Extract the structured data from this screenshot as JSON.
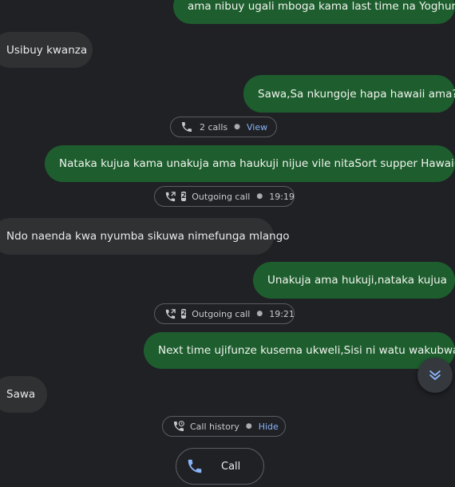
{
  "messages": [
    {
      "dir": "out",
      "text": "ama nibuy ugali mboga kama last time na Yoghurt?"
    },
    {
      "dir": "in",
      "text": "Usibuy kwanza"
    },
    {
      "dir": "out",
      "text": "Sawa,Sa nkungoje hapa hawaii ama?"
    },
    {
      "dir": "out",
      "text": "Nataka kujua kama unakuja ama haukuji nijue vile nitaSort supper Hawaii?"
    },
    {
      "dir": "in",
      "text": "Ndo naenda kwa nyumba sikuwa nimefunga mlango"
    },
    {
      "dir": "out",
      "text": "Unakuja ama hukuji,nataka kujua"
    },
    {
      "dir": "out",
      "text": "Next time ujifunze kusema ukweli,Sisi ni watu wakubwa"
    },
    {
      "dir": "in",
      "text": "Sawa"
    }
  ],
  "calls_chip": {
    "count_label": "2 calls",
    "action": "View"
  },
  "outgoing_calls": [
    {
      "sim": "2",
      "label": "Outgoing call",
      "time": "19:19"
    },
    {
      "sim": "2",
      "label": "Outgoing call",
      "time": "19:21"
    }
  ],
  "history_chip": {
    "label": "Call history",
    "action": "Hide"
  },
  "call_button": {
    "label": "Call"
  },
  "colors": {
    "outgoing_bubble": "#1e5e2e",
    "incoming_bubble": "#2f3133",
    "link": "#8ab4f8",
    "background": "#1f2125"
  }
}
